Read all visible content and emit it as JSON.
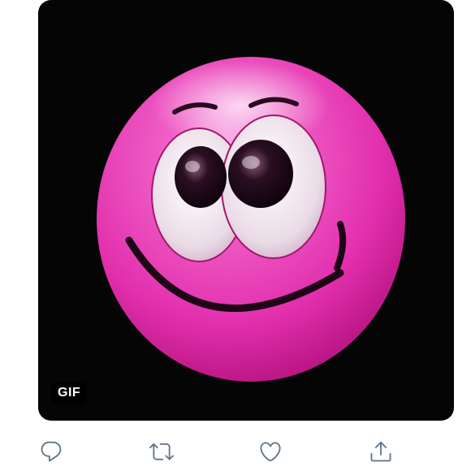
{
  "media": {
    "badge_label": "GIF",
    "image_description_icon": "pink-smiley-emoji",
    "colors": {
      "background": "#050505",
      "face": "#e83fb8",
      "eye_white": "#f3eef2",
      "pupil": "#1a0a14"
    }
  },
  "actions": [
    {
      "icon": "reply-icon"
    },
    {
      "icon": "retweet-icon"
    },
    {
      "icon": "like-icon"
    },
    {
      "icon": "share-icon"
    }
  ],
  "colors": {
    "icon": "#657786"
  }
}
